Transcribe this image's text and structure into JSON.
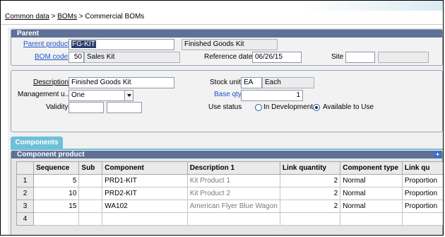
{
  "breadcrumb": {
    "part1": "Common data",
    "sep1": " > ",
    "part2": "BOMs",
    "sep2": " > ",
    "part3": "Commercial BOMs"
  },
  "parent": {
    "heading": "Parent",
    "parent_product_label": "Parent product",
    "parent_product_value": "FG-KIT",
    "parent_product_desc": "Finished Goods Kit",
    "bom_code_label": "BOM code",
    "bom_code_value": "50",
    "bom_code_desc": "Sales Kit",
    "reference_date_label": "Reference date",
    "reference_date_value": "06/26/15",
    "site_label": "Site",
    "site_value": "",
    "site_desc": ""
  },
  "details": {
    "description_label": "Description",
    "description_value": "Finished Goods Kit",
    "management_label": "Management u...",
    "management_value": "One",
    "validity_label": "Validity",
    "validity_from": "",
    "validity_to": "",
    "stock_unit_label": "Stock unit",
    "stock_unit_code": "EA",
    "stock_unit_desc": "Each",
    "base_qty_label": "Base qty",
    "base_qty_value": "1",
    "use_status_label": "Use status",
    "use_status_options": [
      "In Development",
      "Available to Use"
    ],
    "use_status_selected": "Available to Use"
  },
  "tabs": {
    "components": "Components"
  },
  "component_section": {
    "heading": "Component product"
  },
  "grid": {
    "columns": [
      "",
      "Sequence",
      "Sub",
      "Component",
      "Description 1",
      "Link quantity",
      "Component type",
      "Link qu"
    ],
    "rows": [
      {
        "num": "1",
        "sequence": "5",
        "sub": "",
        "component": "PRD1-KIT",
        "description": "Kit Product 1",
        "link_qty": "2",
        "type": "Normal",
        "link_qu": "Proportion"
      },
      {
        "num": "2",
        "sequence": "10",
        "sub": "",
        "component": "PRD2-KIT",
        "description": "Kit Product 2",
        "link_qty": "2",
        "type": "Normal",
        "link_qu": "Proportion"
      },
      {
        "num": "3",
        "sequence": "15",
        "sub": "",
        "component": "WA102",
        "description": "American Flyer Blue Wagon",
        "link_qty": "2",
        "type": "Normal",
        "link_qu": "Proportion"
      },
      {
        "num": "4",
        "sequence": "",
        "sub": "",
        "component": "",
        "description": "",
        "link_qty": "",
        "type": "",
        "link_qu": ""
      }
    ]
  },
  "colors": {
    "section_header": "#5e7196",
    "tab_active": "#6ec0d8",
    "link": "#2255cc"
  }
}
